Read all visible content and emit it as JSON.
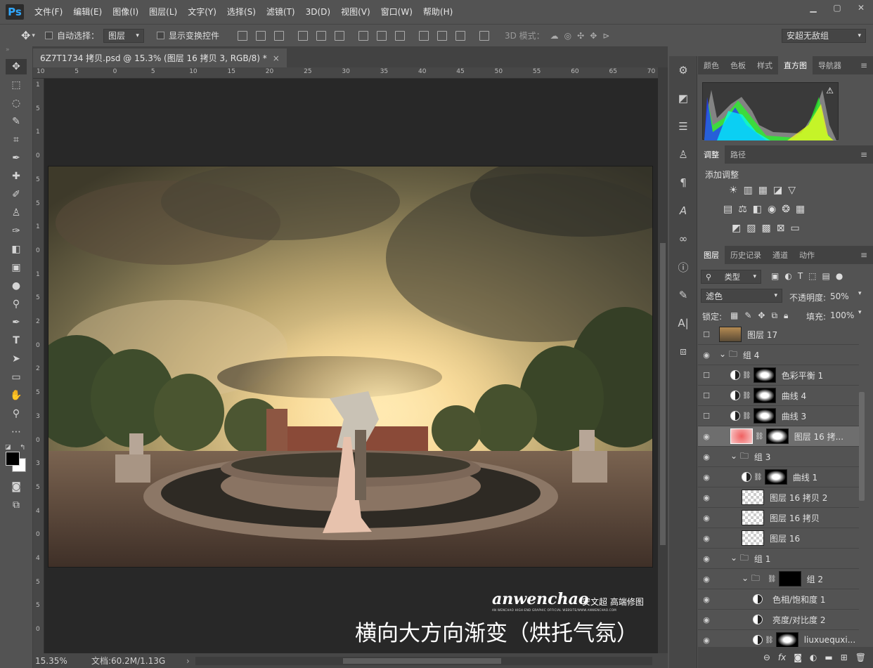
{
  "menubar": {
    "logo": "Ps",
    "items": [
      "文件(F)",
      "编辑(E)",
      "图像(I)",
      "图层(L)",
      "文字(Y)",
      "选择(S)",
      "滤镜(T)",
      "3D(D)",
      "视图(V)",
      "窗口(W)",
      "帮助(H)"
    ]
  },
  "options": {
    "auto_select_label": "自动选择：",
    "auto_select_target": "图层",
    "show_transform_label": "显示变换控件",
    "mode_3d_label": "3D 模式：",
    "workspace": "安超无敌组"
  },
  "document": {
    "tab_title": "6Z7T1734 拷贝.psd @ 15.3% (图层 16 拷贝 3, RGB/8) *",
    "tab_close": "×",
    "ruler_ticks": [
      "10",
      "5",
      "0",
      "5",
      "10",
      "15",
      "20",
      "25",
      "30",
      "35",
      "40",
      "45",
      "50",
      "55",
      "60",
      "65",
      "70"
    ],
    "ruler_left_ticks": [
      "1",
      "5",
      "1",
      "0",
      "5",
      "5",
      "1",
      "0",
      "1",
      "5",
      "2",
      "0",
      "2",
      "5",
      "3",
      "0",
      "3",
      "5",
      "4",
      "0",
      "4",
      "5",
      "5",
      "0"
    ],
    "watermark_logo": "anwenchao",
    "watermark_cn": "安文超 高端修图",
    "watermark_small": "AN WENCHAO HIGH-END GRAPHIC OFFICIAL WEBSITE/WWW.ANWENCHAO.COM",
    "caption": "横向大方向渐变（烘托气氛）"
  },
  "status": {
    "zoom": "15.35%",
    "doc_info": "文档:60.2M/1.13G",
    "arrow": "›"
  },
  "panels": {
    "top_tabs": [
      "颜色",
      "色板",
      "样式",
      "直方图",
      "导航器"
    ],
    "top_active": "直方图",
    "adj_tabs": [
      "调整",
      "路径"
    ],
    "adj_title": "添加调整",
    "layer_tabs": [
      "图层",
      "历史记录",
      "通道",
      "动作"
    ],
    "filter_kind": "类型",
    "blend_mode": "滤色",
    "opacity_label": "不透明度:",
    "opacity_value": "50%",
    "lock_label": "锁定:",
    "fill_label": "填充:",
    "fill_value": "100%"
  },
  "layers": [
    {
      "name": "图层 17",
      "visible": false,
      "indent": 0,
      "kind": "photo"
    },
    {
      "name": "组 4",
      "visible": true,
      "indent": 0,
      "kind": "group"
    },
    {
      "name": "色彩平衡 1",
      "visible": false,
      "indent": 1,
      "kind": "adj"
    },
    {
      "name": "曲线 4",
      "visible": false,
      "indent": 1,
      "kind": "adj"
    },
    {
      "name": "曲线 3",
      "visible": false,
      "indent": 1,
      "kind": "adj"
    },
    {
      "name": "图层 16 拷...",
      "visible": true,
      "indent": 1,
      "kind": "selected"
    },
    {
      "name": "组 3",
      "visible": true,
      "indent": 1,
      "kind": "group"
    },
    {
      "name": "曲线 1",
      "visible": true,
      "indent": 2,
      "kind": "adj"
    },
    {
      "name": "图层 16 拷贝 2",
      "visible": true,
      "indent": 2,
      "kind": "trans"
    },
    {
      "name": "图层 16 拷贝",
      "visible": true,
      "indent": 2,
      "kind": "trans"
    },
    {
      "name": "图层 16",
      "visible": true,
      "indent": 2,
      "kind": "trans"
    },
    {
      "name": "组 1",
      "visible": true,
      "indent": 1,
      "kind": "group"
    },
    {
      "name": "组 2",
      "visible": true,
      "indent": 2,
      "kind": "group2"
    },
    {
      "name": "色相/饱和度 1",
      "visible": true,
      "indent": 3,
      "kind": "adjonly"
    },
    {
      "name": "亮度/对比度 2",
      "visible": true,
      "indent": 3,
      "kind": "adjonly"
    },
    {
      "name": "liuxuequxi...",
      "visible": true,
      "indent": 3,
      "kind": "adj"
    }
  ],
  "colors": {
    "accent": "#31a8ff",
    "bg": "#535353",
    "selected_layer": "#6e6e6e"
  }
}
